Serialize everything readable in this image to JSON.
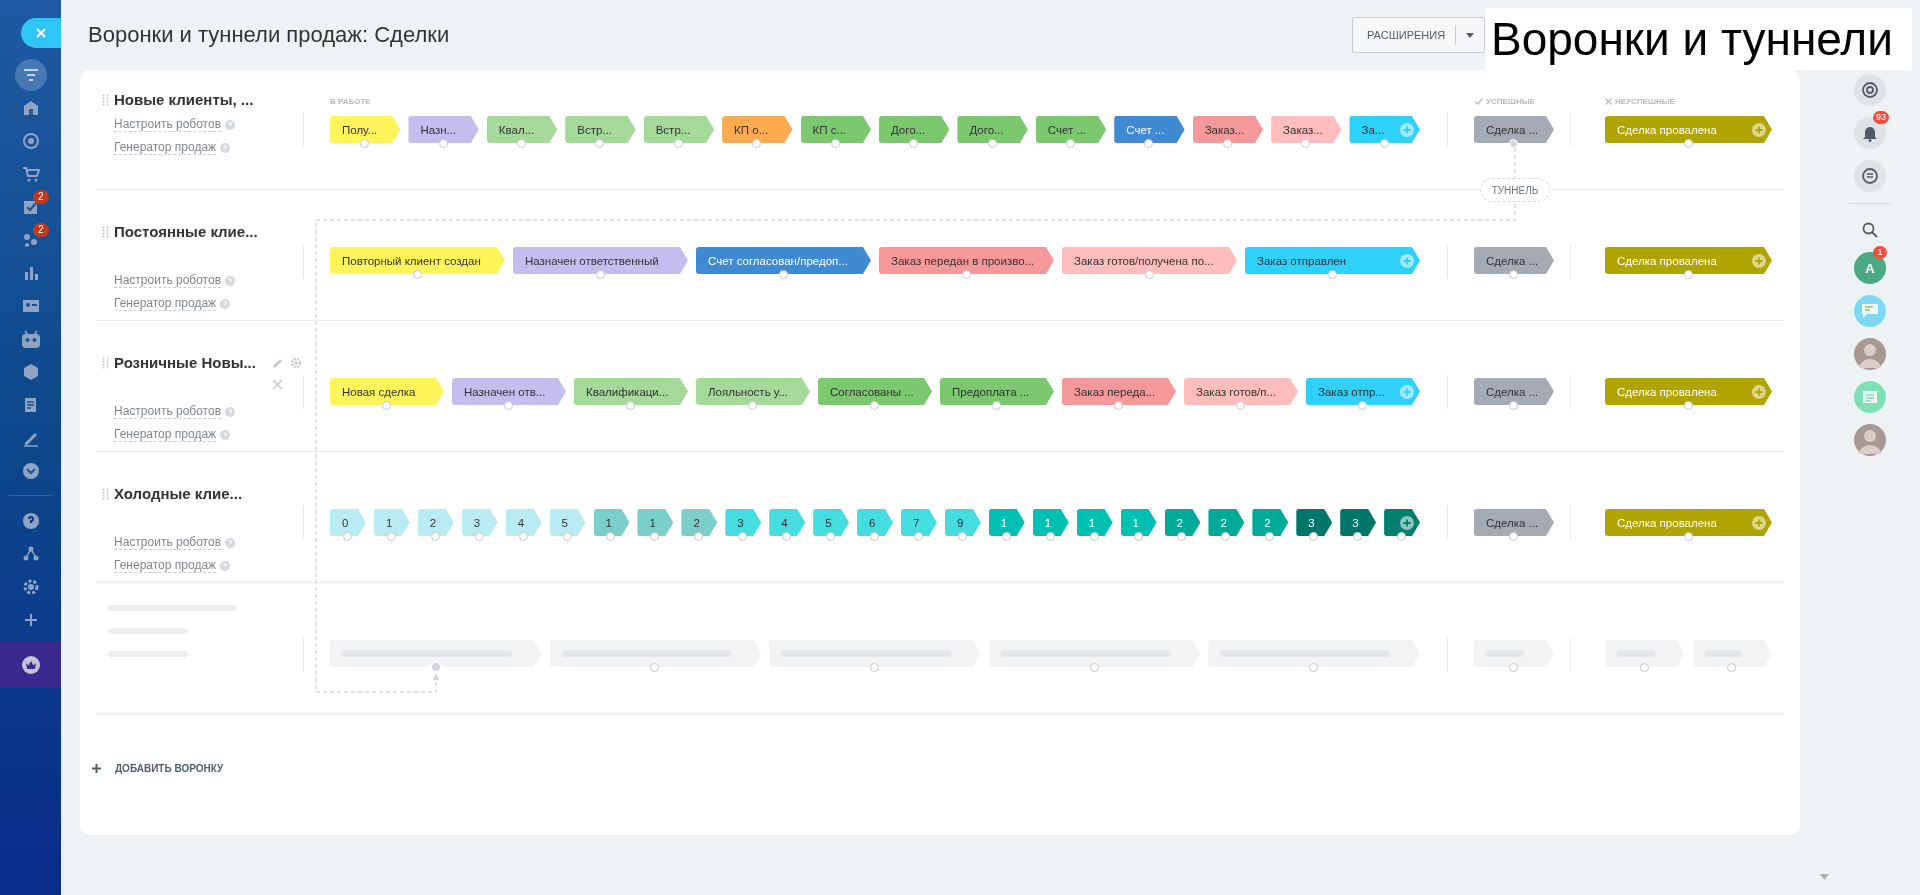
{
  "header": {
    "title": "Воронки и туннели продаж: Сделки",
    "extensions_button": "РАСШИРЕНИЯ"
  },
  "caption": "Воронки и туннели",
  "sidebar": {
    "items": [
      {
        "kind": "filter",
        "selected": true
      },
      {
        "kind": "home",
        "selected": false
      },
      {
        "kind": "target",
        "selected": false
      },
      {
        "kind": "cart",
        "selected": false
      },
      {
        "kind": "tasks",
        "selected": false,
        "badge": "2"
      },
      {
        "kind": "groups",
        "selected": false,
        "badge": "2"
      },
      {
        "kind": "chart",
        "selected": false
      },
      {
        "kind": "contact",
        "selected": false
      },
      {
        "kind": "robot",
        "selected": false
      },
      {
        "kind": "box",
        "selected": false
      },
      {
        "kind": "doc",
        "selected": false
      },
      {
        "kind": "sign",
        "selected": false
      },
      {
        "kind": "more",
        "selected": false
      },
      {
        "kind": "help",
        "selected": false
      },
      {
        "kind": "sitemap",
        "selected": false
      },
      {
        "kind": "settings",
        "selected": false
      },
      {
        "kind": "add",
        "selected": false
      },
      {
        "kind": "crown",
        "selected": false
      }
    ]
  },
  "stage_groups": {
    "in_progress": "В РАБОТЕ",
    "success": "УСПЕШНЫЕ",
    "failure": "НЕУСПЕШНЫЕ"
  },
  "funnels": [
    {
      "title": "Новые клиенты, ...",
      "links": [
        "Настроить роботов",
        "Генератор продаж"
      ],
      "hovered": false,
      "stages": [
        {
          "name": "Полу...",
          "color": "#fff55a"
        },
        {
          "name": "Назн...",
          "color": "#c6bdef"
        },
        {
          "name": "Квал...",
          "color": "#a5d99a"
        },
        {
          "name": "Встр...",
          "color": "#a5d99a"
        },
        {
          "name": "Встр...",
          "color": "#a5d99a"
        },
        {
          "name": "КП о...",
          "color": "#ffab52"
        },
        {
          "name": "КП с...",
          "color": "#7bc86f"
        },
        {
          "name": "Дого...",
          "color": "#7bc86f"
        },
        {
          "name": "Дого...",
          "color": "#7bc86f"
        },
        {
          "name": "Счет ...",
          "color": "#7bc86f"
        },
        {
          "name": "Счет ...",
          "color": "#3f8ad0"
        },
        {
          "name": "Заказ...",
          "color": "#f5989a"
        },
        {
          "name": "Заказ...",
          "color": "#ffbdbd"
        },
        {
          "name": "За...",
          "color": "#2fd1fa"
        }
      ],
      "success": {
        "name": "Сделка ...",
        "color": "#a5abb5"
      },
      "failure": {
        "name": "Сделка провалена",
        "color": "#b0a400"
      }
    },
    {
      "title": "Постоянные клие...",
      "links": [
        "Настроить роботов",
        "Генератор продаж"
      ],
      "hovered": false,
      "stages": [
        {
          "name": "Повторный клиент создан",
          "color": "#fff55a"
        },
        {
          "name": "Назначен ответственный",
          "color": "#c6bdef"
        },
        {
          "name": "Счет согласован/предоп...",
          "color": "#3f8ad0"
        },
        {
          "name": "Заказ передан в произво...",
          "color": "#f5989a"
        },
        {
          "name": "Заказ готов/получена по...",
          "color": "#ffbdbd"
        },
        {
          "name": "Заказ отправлен",
          "color": "#2fd1fa"
        }
      ],
      "success": {
        "name": "Сделка ...",
        "color": "#a5abb5"
      },
      "failure": {
        "name": "Сделка провалена",
        "color": "#b0a400"
      }
    },
    {
      "title": "Розничные Новы...",
      "links": [
        "Настроить роботов",
        "Генератор продаж"
      ],
      "hovered": true,
      "stages": [
        {
          "name": "Новая сделка",
          "color": "#fff55a"
        },
        {
          "name": "Назначен отв...",
          "color": "#c6bdef"
        },
        {
          "name": "Квалификаци...",
          "color": "#a5d99a"
        },
        {
          "name": "Лояльность у...",
          "color": "#a5d99a"
        },
        {
          "name": "Согласованы ...",
          "color": "#7bc86f"
        },
        {
          "name": "Предоплата ...",
          "color": "#7bc86f"
        },
        {
          "name": "Заказ переда...",
          "color": "#f5989a"
        },
        {
          "name": "Заказ готов/п...",
          "color": "#ffbdbd"
        },
        {
          "name": "Заказ отпр...",
          "color": "#2fd1fa"
        }
      ],
      "success": {
        "name": "Сделка ...",
        "color": "#a5abb5"
      },
      "failure": {
        "name": "Сделка провалена",
        "color": "#b0a400"
      }
    },
    {
      "title": "Холодные клие...",
      "links": [
        "Настроить роботов",
        "Генератор продаж"
      ],
      "hovered": false,
      "stages": [
        {
          "name": "0",
          "color": "#b8ecf2"
        },
        {
          "name": "1",
          "color": "#b8ecf2"
        },
        {
          "name": "2",
          "color": "#b8ecf2"
        },
        {
          "name": "3",
          "color": "#b8ecf2"
        },
        {
          "name": "4",
          "color": "#b8ecf2"
        },
        {
          "name": "5",
          "color": "#b8ecf2"
        },
        {
          "name": "1",
          "color": "#7acfcb"
        },
        {
          "name": "1",
          "color": "#7acfcb"
        },
        {
          "name": "2",
          "color": "#7acfcb"
        },
        {
          "name": "3",
          "color": "#45dde0"
        },
        {
          "name": "4",
          "color": "#45dde0"
        },
        {
          "name": "5",
          "color": "#45dde0"
        },
        {
          "name": "6",
          "color": "#45dde0"
        },
        {
          "name": "7",
          "color": "#45dde0"
        },
        {
          "name": "9",
          "color": "#45dde0"
        },
        {
          "name": "1",
          "color": "#00bfb3"
        },
        {
          "name": "1",
          "color": "#00bfb3"
        },
        {
          "name": "1",
          "color": "#00bfb3"
        },
        {
          "name": "1",
          "color": "#00bfb3"
        },
        {
          "name": "2",
          "color": "#00aa99"
        },
        {
          "name": "2",
          "color": "#00aa99"
        },
        {
          "name": "2",
          "color": "#00aa99"
        },
        {
          "name": "3",
          "color": "#00766a"
        },
        {
          "name": "3",
          "color": "#00766a"
        },
        {
          "color": "#00806f"
        }
      ],
      "success": {
        "name": "Сделка ...",
        "color": "#a5abb5"
      },
      "failure": {
        "name": "Сделка провалена",
        "color": "#b0a400"
      }
    }
  ],
  "tunnel": {
    "label": "ТУННЕЛЬ"
  },
  "add_funnel": "ДОБАВИТЬ ВОРОНКУ",
  "right_panel": {
    "items": [
      {
        "kind": "refresh"
      },
      {
        "kind": "bell",
        "badge": "93"
      },
      {
        "kind": "chat"
      },
      {
        "kind": "search"
      },
      {
        "kind": "letter",
        "letter": "A",
        "badge": "1"
      },
      {
        "kind": "messages"
      },
      {
        "kind": "person"
      },
      {
        "kind": "news"
      },
      {
        "kind": "person"
      }
    ]
  }
}
